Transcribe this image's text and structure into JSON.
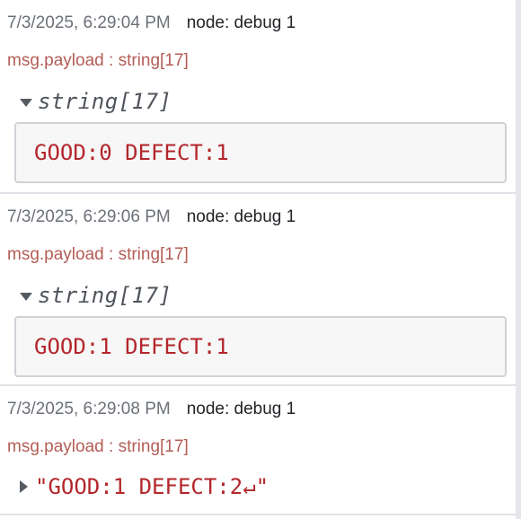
{
  "messages": [
    {
      "timestamp": "7/3/2025, 6:29:04 PM",
      "node": "node: debug 1",
      "topic": "msg.payload : string[17]",
      "type_label": "string[17]",
      "value": "GOOD:0 DEFECT:1",
      "expanded": true
    },
    {
      "timestamp": "7/3/2025, 6:29:06 PM",
      "node": "node: debug 1",
      "topic": "msg.payload : string[17]",
      "type_label": "string[17]",
      "value": "GOOD:1 DEFECT:1",
      "expanded": true
    },
    {
      "timestamp": "7/3/2025, 6:29:08 PM",
      "node": "node: debug 1",
      "topic": "msg.payload : string[17]",
      "value": "\"GOOD:1 DEFECT:2↵\"",
      "expanded": false
    }
  ],
  "icons": {
    "expanded": "caret-down-icon",
    "collapsed": "caret-right-icon"
  },
  "colors": {
    "timestamp": "#6b7078",
    "node": "#222428",
    "topic": "#b35d56",
    "value": "#b3262b",
    "type_label": "#4f545b",
    "value_box_bg": "#f7f7f7",
    "value_box_border": "#cfd3d8"
  }
}
